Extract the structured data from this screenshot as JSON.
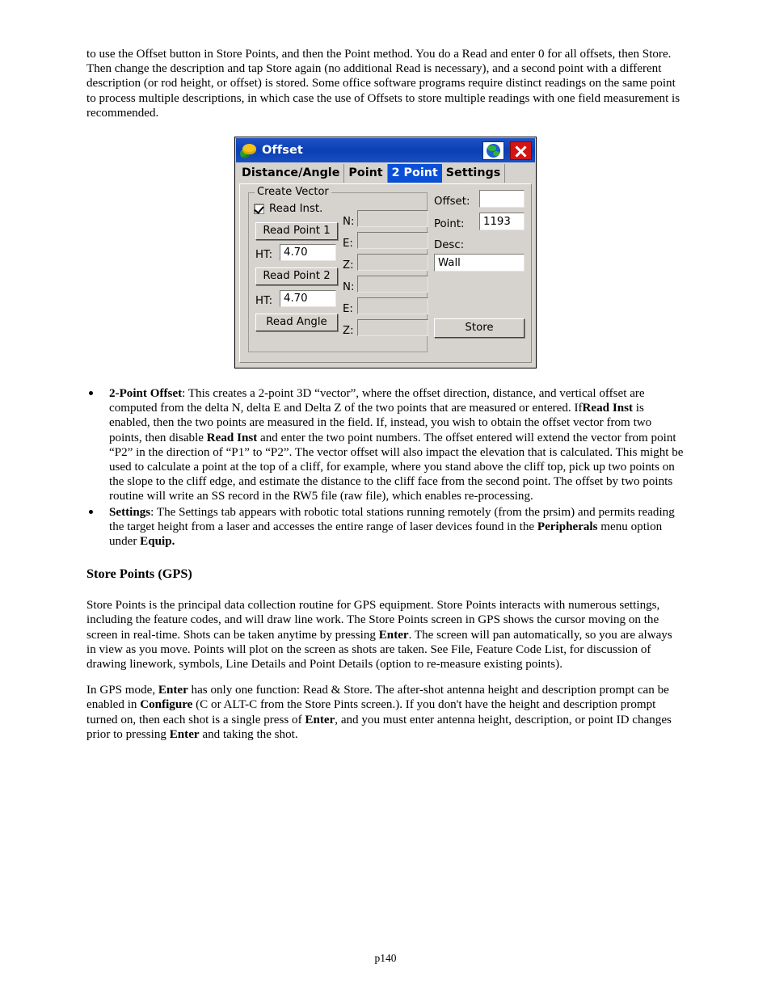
{
  "page": {
    "footer": "p140"
  },
  "body": {
    "intro_paragraph": "to use the Offset button in Store Points, and then the Point method.  You do a Read and enter 0 for all offsets, then Store.  Then change the description and tap Store again (no additional Read is necessary), and a second point with a different description (or rod height, or offset) is stored.  Some office software programs require distinct readings on the same point to process multiple descriptions, in which case the use of Offsets to store multiple readings with one field measurement is recommended.",
    "bullets": [
      {
        "term": "2-Point Offset",
        "text": ": This creates a 2-point 3D “vector”, where the offset direction, distance, and vertical offset are computed from the delta N, delta E and Delta Z of the two points that are measured or entered.  If",
        "term2": "Read Inst",
        "text2": " is enabled, then the two points are measured in the field. If, instead, you wish to obtain the offset vector from two points, then disable ",
        "term3": "Read Inst",
        "text3": " and enter the two point numbers. The offset entered will extend the vector from point “P2” in the direction of “P1” to “P2”.  The vector offset will also impact the elevation that is calculated.  This might be used to calculate a point at the top of a cliff, for example, where you stand above the cliff top, pick up two points on the slope to the cliff edge, and estimate the distance to the cliff face from the second point.  The offset by two points routine will write an SS record in the RW5 file (raw file), which enables re-processing."
      },
      {
        "term": "Settings",
        "text": ": The Settings tab appears with robotic total stations running remotely (from the prsim) and permits reading the target height from a laser and accesses the entire range of laser devices found in the ",
        "term2": "Peripherals",
        "text2": " menu option under ",
        "term3": "Equip.",
        "text3": ""
      }
    ],
    "section_heading": "Store Points (GPS)",
    "gps_paragraph_1": "Store Points is the principal data collection routine for GPS equipment.  Store Points interacts with numerous settings, including the feature codes, and will draw line work.  The Store Points screen in GPS shows the cursor moving on the screen in real-time.  Shots can be taken anytime by pressing ",
    "gps_p1_bold": "Enter",
    "gps_paragraph_1b": ".  The screen will pan automatically, so you are always in view as you move.  Points will plot on the screen as shots are taken.  See File, Feature Code List, for discussion of drawing linework, symbols, Line Details and Point Details (option to re-measure existing points).",
    "gps_p2_a": "In GPS mode, ",
    "gps_p2_b1": "Enter",
    "gps_p2_b": " has only one function:  Read & Store.  The after-shot antenna height and description prompt can be enabled in ",
    "gps_p2_b2": "Configure",
    "gps_p2_c": " (C or ALT-C from the Store Pints screen.). If you don't have the height and description prompt turned on, then each shot is a single press of ",
    "gps_p2_b3": "Enter",
    "gps_p2_d": ", and you must enter antenna height, description, or point ID changes prior to pressing ",
    "gps_p2_b4": "Enter",
    "gps_p2_e": " and taking the shot."
  },
  "dialog": {
    "title": "Offset",
    "icons": {
      "app": "offset-app-icon",
      "help_globe": "globe-icon",
      "close": "close-icon"
    },
    "colors": {
      "titlebar": "#0a3fb5",
      "active_tab": "#0a4fd6",
      "close_button": "#d41414",
      "face": "#d6d3ce"
    },
    "tabs": [
      {
        "label": "Distance/Angle",
        "active": false
      },
      {
        "label": "Point",
        "active": false
      },
      {
        "label": "2 Point",
        "active": true
      },
      {
        "label": "Settings",
        "active": false
      }
    ],
    "group": {
      "label": "Create Vector",
      "read_inst_label": "Read Inst.",
      "read_inst_checked": true,
      "read_point_1": "Read Point 1",
      "read_point_2": "Read Point 2",
      "read_angle": "Read Angle",
      "ht_label_1": "HT:",
      "ht_value_1": "4.70",
      "ht_label_2": "HT:",
      "ht_value_2": "4.70",
      "p1_n_label": "N:",
      "p1_n_value": "",
      "p1_e_label": "E:",
      "p1_e_value": "",
      "p1_z_label": "Z:",
      "p1_z_value": "",
      "p2_n_label": "N:",
      "p2_n_value": "",
      "p2_e_label": "E:",
      "p2_e_value": "",
      "p2_z_label": "Z:",
      "p2_z_value": ""
    },
    "right": {
      "offset_label": "Offset:",
      "offset_value": "",
      "point_label": "Point:",
      "point_value": "1193",
      "desc_label": "Desc:",
      "desc_value": "Wall",
      "store_button": "Store"
    }
  }
}
